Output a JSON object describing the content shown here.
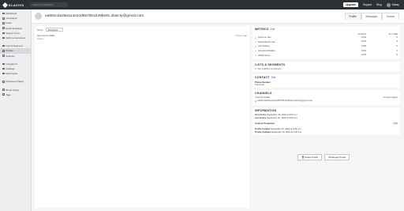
{
  "topbar": {
    "logo": "KLAVIYO",
    "search_placeholder": "Search for anything",
    "upgrade": "Upgrade",
    "support": "Support",
    "blog": "Blog",
    "user": "Klassy"
  },
  "sidebar": {
    "items": [
      {
        "label": "Dashboard",
        "icon": "dashboard-icon"
      },
      {
        "label": "Campaigns",
        "icon": "megaphone-icon"
      },
      {
        "label": "Flows",
        "icon": "flow-icon"
      },
      {
        "label": "Email Templates",
        "icon": "template-icon"
      },
      {
        "label": "Signup Forms",
        "icon": "form-icon"
      },
      {
        "label": "SMS Conversations",
        "icon": "chat-icon"
      },
      {
        "label": "Lists & Segments",
        "icon": "list-icon"
      },
      {
        "label": "Profiles",
        "icon": "profile-icon",
        "active": true
      },
      {
        "label": "Analytics",
        "icon": "chart-icon"
      },
      {
        "label": "Integrations",
        "icon": "plug-icon"
      },
      {
        "label": "Catalogs",
        "icon": "catalog-icon"
      },
      {
        "label": "Data Feeds",
        "icon": "feed-icon"
      },
      {
        "label": "Preference Pages",
        "icon": "page-icon"
      },
      {
        "label": "Brand Library",
        "icon": "library-icon"
      },
      {
        "label": "Tags",
        "icon": "tag-icon"
      }
    ]
  },
  "header": {
    "title": "ea691c0a25ea14e24d5575b1b49be8c.diascty@gmail.com",
    "tabs": [
      "Profile",
      "Messages",
      "Scores"
    ]
  },
  "activity": {
    "filter_label": "Show",
    "filter_value": "All Metrics",
    "events": [
      {
        "title": "Opt Out for SMS",
        "sub": "Pursuit",
        "time": "7 hours ago"
      }
    ]
  },
  "metrics": {
    "title": "METRICS",
    "edit": "Edit",
    "col1": "30 DAYS",
    "col2": "ALL TIME",
    "rows": [
      {
        "name": "Active on Site",
        "v1": "0.0%",
        "v2": "0"
      },
      {
        "name": "Subscribed to List",
        "v1": "0.0%",
        "v2": "0"
      },
      {
        "name": "Job Viewing",
        "v1": "0.0%",
        "v2": "0"
      },
      {
        "name": "Account Activation",
        "v1": "0.0%",
        "v2": "0"
      },
      {
        "name": "HPRS Score",
        "v1": "0.0%",
        "v2": "0"
      }
    ]
  },
  "lists": {
    "title": "LISTS & SEGMENTS",
    "text": "1 / Top 3 HPR to Customers"
  },
  "contact": {
    "title": "CONTACT",
    "edit": "Edit",
    "phone_label": "Phone Number",
    "phone_value": "Subscribe"
  },
  "channels": {
    "title": "CHANNELS",
    "col_left": "Channel Details",
    "col_right": "Consent Status",
    "email": "ea691c0a25ea14e24d5575b1b49be8c.diascty@gmail.com"
  },
  "information": {
    "title": "INFORMATION",
    "first_active_label": "First Active",
    "first_active": "September 15, 2023 at 3:06 a.m.",
    "last_active_label": "Last Active",
    "last_active": "September 15, 2023 at 3:06 a.m.",
    "custom_props": "Custom Properties",
    "add": "Add",
    "created_label": "Profile Created",
    "created": "September 15, 2023 at 3:06 a.m.",
    "updated_label": "Profile Updated",
    "updated": "September 15, 2023 at 3:06 a.m."
  },
  "footer": {
    "delete": "Delete Profile",
    "suppress": "Manage Profile"
  }
}
